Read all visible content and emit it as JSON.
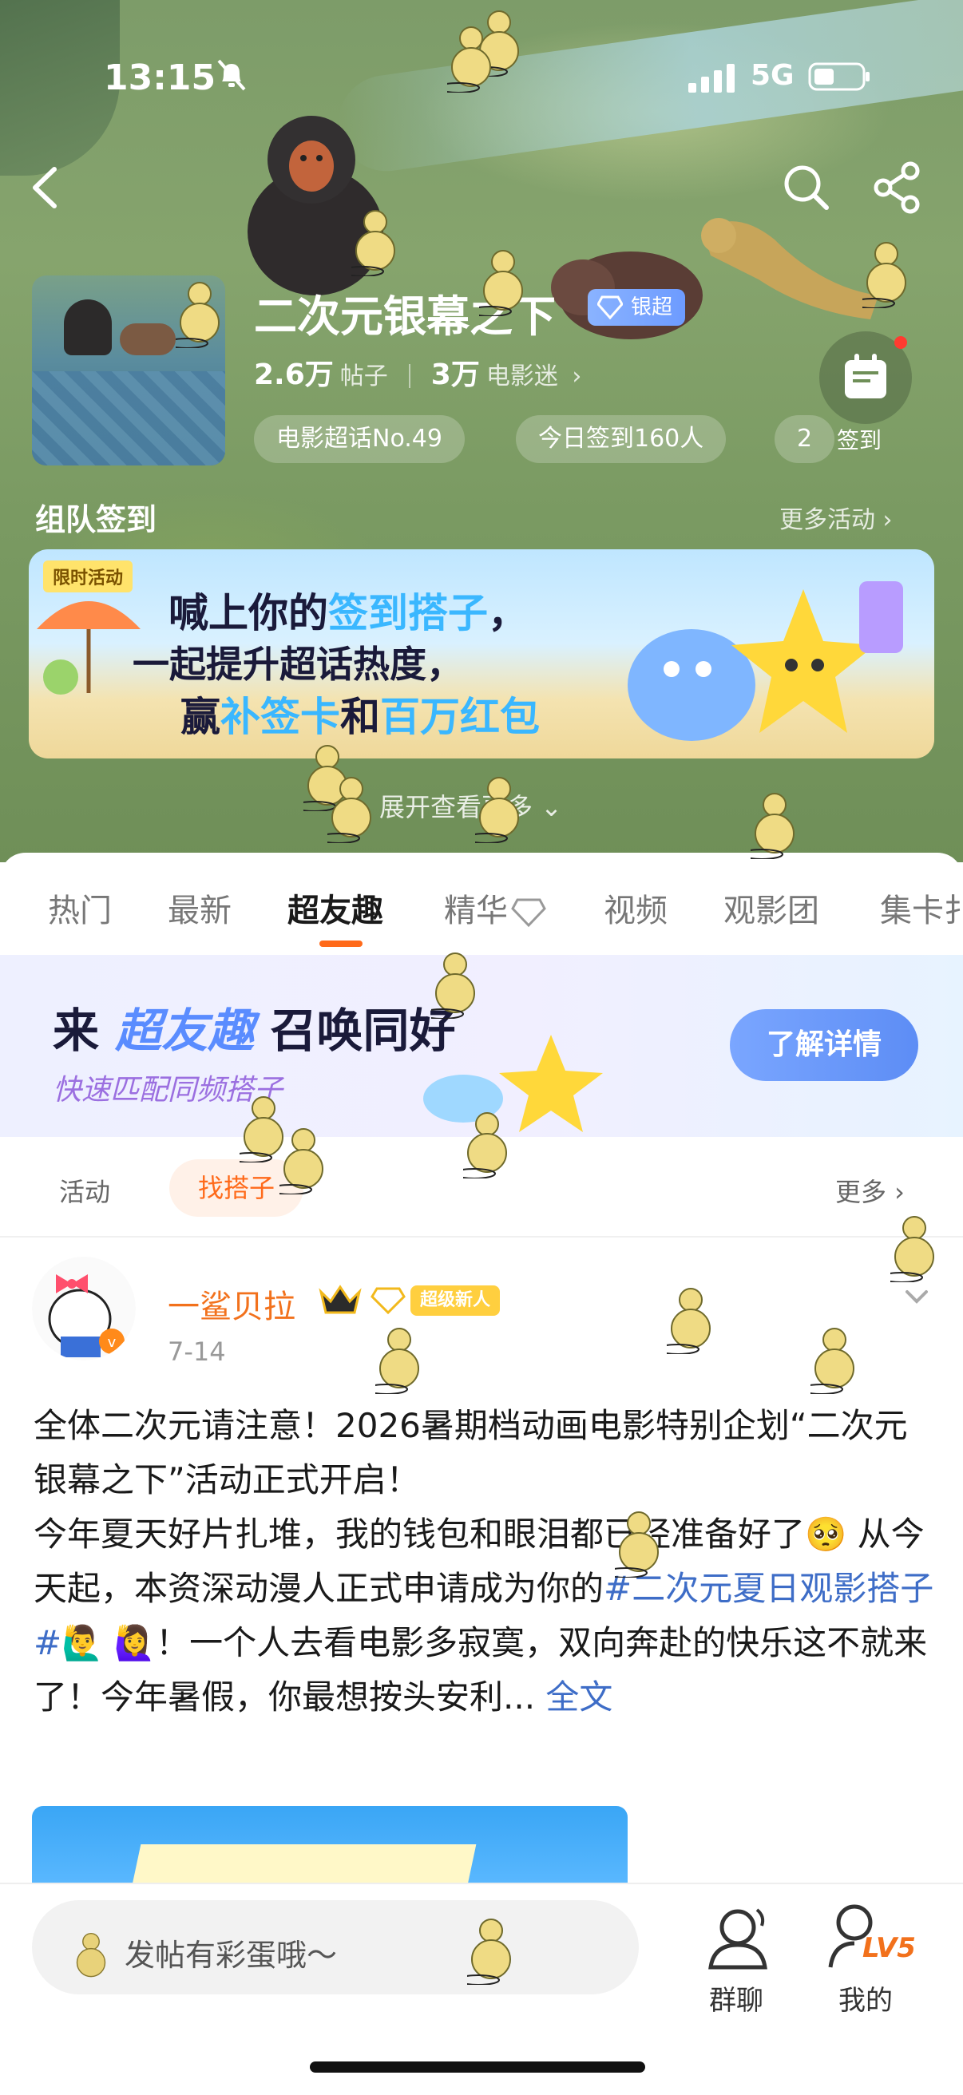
{
  "status_bar": {
    "time": "13:15",
    "network": "5G"
  },
  "header": {
    "title": "二次元银幕之下",
    "badge": "银超",
    "posts_count": "2.6万",
    "posts_label": "帖子",
    "fans_count": "3万",
    "fans_label": "电影迷",
    "pills": [
      "电影超话No.49",
      "今日签到160人",
      "2"
    ],
    "checkin_label": "签到"
  },
  "team_checkin": {
    "title": "组队签到",
    "more": "更多活动 ›",
    "banner": {
      "tag": "限时活动",
      "line1_a": "喊上你的",
      "line1_b": "签到搭子",
      "line1_c": "，",
      "line2": "一起提升超话热度，",
      "line3_a": "赢",
      "line3_b": "补签卡",
      "line3_c": "和",
      "line3_d": "百万红包"
    },
    "expand": "展开查看更多 ⌄"
  },
  "tabs": [
    "热门",
    "最新",
    "超友趣",
    "精华",
    "视频",
    "观影团",
    "集卡扌"
  ],
  "active_tab": "超友趣",
  "promo": {
    "line1_a": "来",
    "line1_b": "超友趣",
    "line1_c": "召唤同好",
    "line2": "快速匹配同频搭子",
    "button": "了解详情"
  },
  "filter": {
    "items": [
      "活动",
      "找搭子"
    ],
    "more": "更多 ›"
  },
  "post": {
    "username": "一鲨贝拉",
    "badge": "超级新人",
    "date": "7-14",
    "text_a": "全体二次元请注意！2026暑期档动画电影特别企划“二次元银幕之下”活动正式开启！",
    "text_b": "今年夏天好片扎堆，我的钱包和眼泪都已经准备好了🥺 从今天起，本资深动漫人正式申请成为你的",
    "hashtag": "#二次元夏日观影搭子#",
    "text_c": "🙋‍♂️ 🙋‍♀️！一个人去看电影多寂寞，双向奔赴的快乐这不就来了！今年暑假，你最想按头安利...",
    "full_text": "全文"
  },
  "bottom_bar": {
    "compose_placeholder": "发帖有彩蛋哦～",
    "group_chat": "群聊",
    "mine": "我的",
    "level": "LV5"
  },
  "colors": {
    "accent": "#ff6a1a",
    "link": "#3e6dc7",
    "username": "#f2711c"
  }
}
